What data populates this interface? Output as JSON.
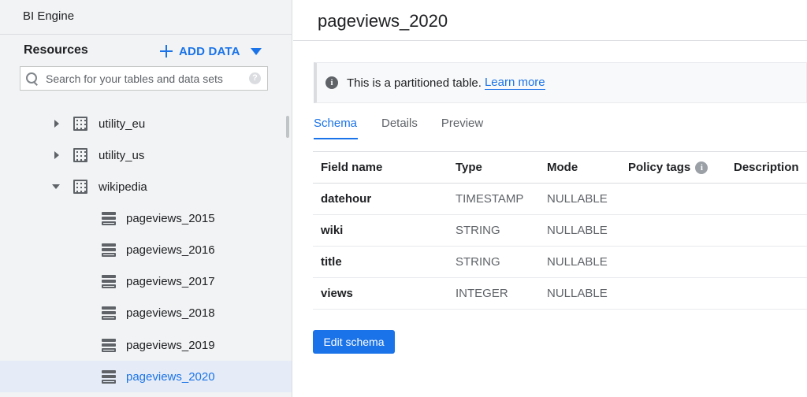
{
  "sidebar": {
    "bi_engine_label": "BI Engine",
    "resources_title": "Resources",
    "add_data_label": "ADD DATA",
    "search_placeholder": "Search for your tables and data sets",
    "help_glyph": "?",
    "tree": [
      {
        "type": "dataset",
        "label": "utility_eu",
        "expanded": false
      },
      {
        "type": "dataset",
        "label": "utility_us",
        "expanded": false
      },
      {
        "type": "dataset",
        "label": "wikipedia",
        "expanded": true
      },
      {
        "type": "table",
        "label": "pageviews_2015"
      },
      {
        "type": "table",
        "label": "pageviews_2016"
      },
      {
        "type": "table",
        "label": "pageviews_2017"
      },
      {
        "type": "table",
        "label": "pageviews_2018"
      },
      {
        "type": "table",
        "label": "pageviews_2019"
      },
      {
        "type": "table",
        "label": "pageviews_2020",
        "selected": true
      }
    ]
  },
  "main": {
    "title": "pageviews_2020",
    "banner": {
      "icon": "info-icon",
      "text": "This is a partitioned table.",
      "link": "Learn more"
    },
    "tabs": [
      {
        "label": "Schema",
        "active": true
      },
      {
        "label": "Details",
        "active": false
      },
      {
        "label": "Preview",
        "active": false
      }
    ],
    "schema": {
      "headers": {
        "field": "Field name",
        "type": "Type",
        "mode": "Mode",
        "policy": "Policy tags",
        "description": "Description"
      },
      "rows": [
        {
          "field": "datehour",
          "type": "TIMESTAMP",
          "mode": "NULLABLE",
          "policy": "",
          "description": ""
        },
        {
          "field": "wiki",
          "type": "STRING",
          "mode": "NULLABLE",
          "policy": "",
          "description": ""
        },
        {
          "field": "title",
          "type": "STRING",
          "mode": "NULLABLE",
          "policy": "",
          "description": ""
        },
        {
          "field": "views",
          "type": "INTEGER",
          "mode": "NULLABLE",
          "policy": "",
          "description": ""
        }
      ]
    },
    "edit_schema_label": "Edit schema"
  },
  "colors": {
    "accent": "#1a73e8",
    "sidebar_bg": "#f1f3f4",
    "selected_bg": "#e6ecf7"
  }
}
